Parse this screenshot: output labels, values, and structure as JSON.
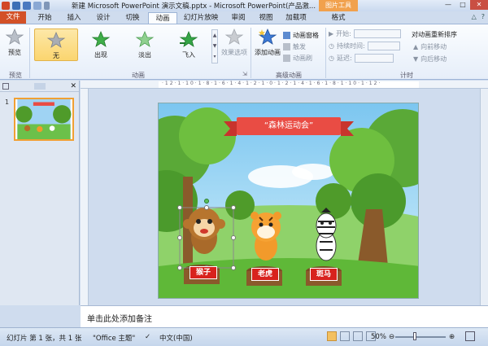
{
  "window": {
    "title": "新建 Microsoft PowerPoint 演示文稿.pptx - Microsoft PowerPoint(产品激...",
    "context_tab": "图片工具"
  },
  "tabs": [
    "文件",
    "开始",
    "插入",
    "设计",
    "切换",
    "动画",
    "幻灯片放映",
    "审阅",
    "视图",
    "加载项",
    "格式"
  ],
  "active_tab": "动画",
  "ribbon": {
    "preview": {
      "label": "预览",
      "group": "预览"
    },
    "animations": [
      "无",
      "出现",
      "淡出",
      "飞入"
    ],
    "effect_options": "效果选项",
    "animation_group": "动画",
    "add_animation": "添加动画",
    "animation_pane": "动画窗格",
    "trigger": "触发",
    "animation_painter": "动画刷",
    "advanced_group": "高级动画",
    "start_label": "开始:",
    "duration_label": "持续时间:",
    "delay_label": "延迟:",
    "reorder_title": "对动画重新排序",
    "move_earlier": "向前移动",
    "move_later": "向后移动",
    "timing_group": "计时"
  },
  "slide_panel": {
    "slide_number": "1",
    "close": "✕"
  },
  "slide": {
    "title": "“森林运动会”",
    "labels": [
      "猴子",
      "老虎",
      "斑马"
    ]
  },
  "notes": {
    "placeholder": "单击此处添加备注"
  },
  "status": {
    "slide_info": "幻灯片 第 1 张，共 1 张",
    "theme": "\"Office 主题\"",
    "language": "中文(中国)",
    "zoom": "50%"
  }
}
